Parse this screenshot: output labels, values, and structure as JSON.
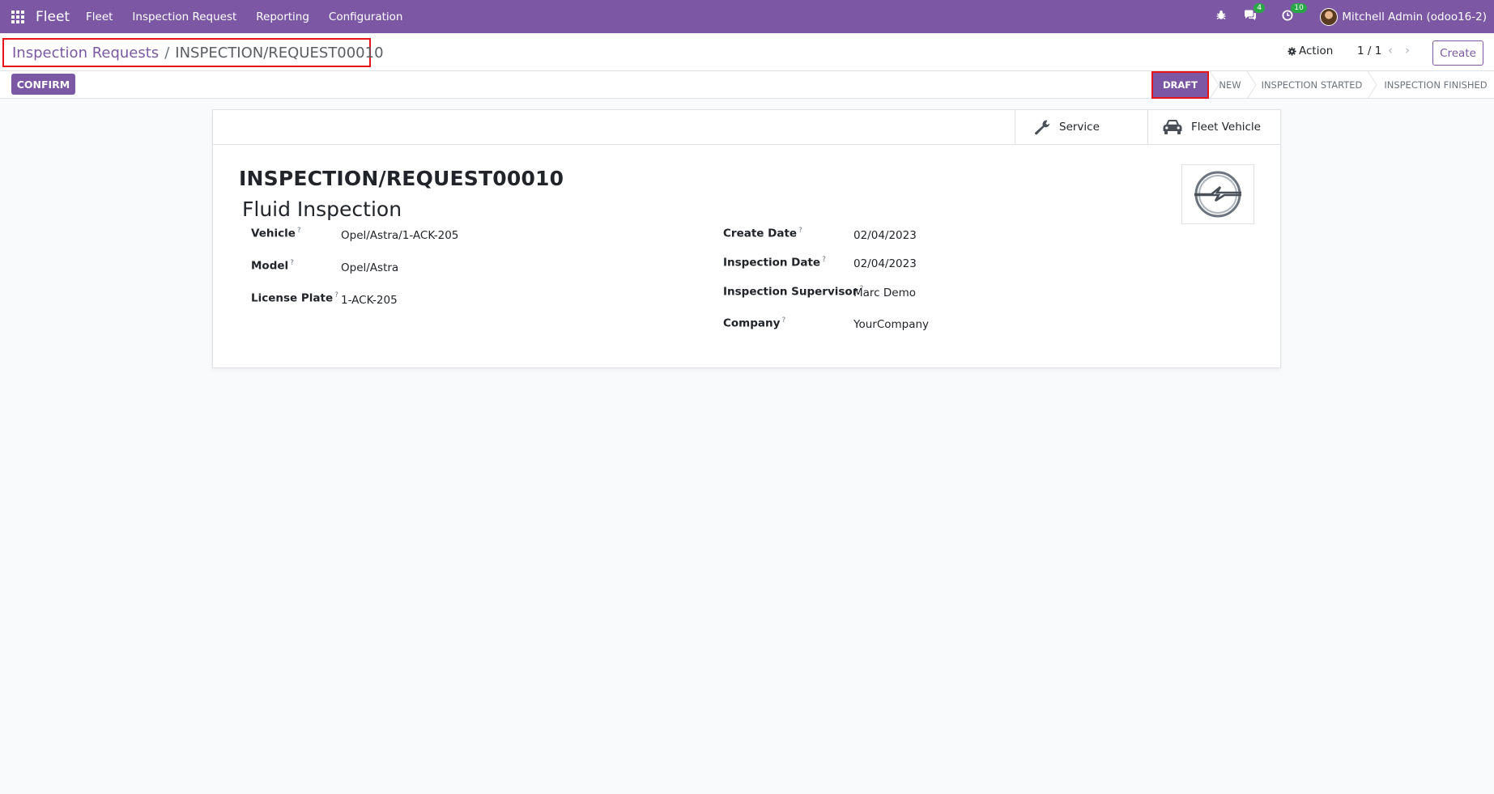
{
  "navbar": {
    "brand": "Fleet",
    "menu": [
      "Fleet",
      "Inspection Request",
      "Reporting",
      "Configuration"
    ],
    "messages_count": "4",
    "activities_count": "10",
    "user": "Mitchell Admin (odoo16-2)"
  },
  "control": {
    "breadcrumb_parent": "Inspection Requests",
    "breadcrumb_separator": "/",
    "breadcrumb_current": "INSPECTION/REQUEST00010",
    "action_label": "Action",
    "pager": "1 / 1",
    "create_label": "Create"
  },
  "statusbar": {
    "confirm_label": "CONFIRM",
    "stages": [
      "DRAFT",
      "NEW",
      "INSPECTION STARTED",
      "INSPECTION FINISHED"
    ],
    "active_stage": "DRAFT"
  },
  "smart_buttons": {
    "service": "Service",
    "fleet_vehicle": "Fleet Vehicle"
  },
  "record": {
    "name": "INSPECTION/REQUEST00010",
    "subtitle": "Fluid Inspection"
  },
  "fields_left": [
    {
      "label": "Vehicle",
      "value": "Opel/Astra/1-ACK-205"
    },
    {
      "label": "Model",
      "value": "Opel/Astra"
    },
    {
      "label": "License Plate",
      "value": "1-ACK-205"
    }
  ],
  "fields_right": [
    {
      "label": "Create Date",
      "value": "02/04/2023"
    },
    {
      "label": "Inspection Date",
      "value": "02/04/2023"
    },
    {
      "label": "Inspection Supervisor",
      "value": "Marc Demo"
    },
    {
      "label": "Company",
      "value": "YourCompany"
    }
  ],
  "help_marker": "?",
  "colors": {
    "brand": "#7c58a4",
    "highlight": "#e8141a",
    "badge": "#28a745"
  }
}
